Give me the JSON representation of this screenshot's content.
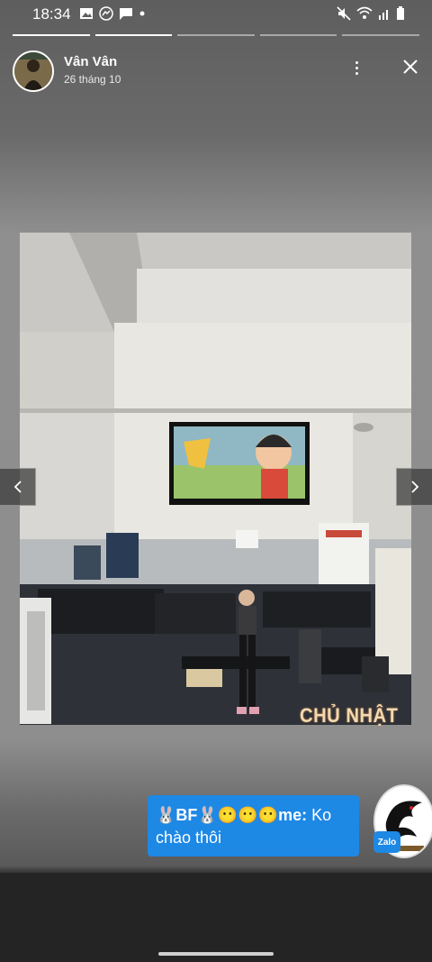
{
  "status_bar": {
    "time": "18:34",
    "left_icons": [
      "gallery-icon",
      "messenger-icon",
      "chat-icon",
      "dot-icon"
    ],
    "right_icons": [
      "mute-icon",
      "wifi-icon",
      "signal-icon",
      "battery-icon"
    ]
  },
  "story": {
    "progress_segments": 5,
    "active_segment": 2,
    "user_name": "Vân Vân",
    "date": "26 tháng 10",
    "caption": "CHỦ NHẬT"
  },
  "chat_bubble": {
    "emoji_prefix": "🐰",
    "bf_label": "BF",
    "emoji_mid": "🐰😶😶😶",
    "me_label": "me:",
    "message_line1": "Ko",
    "message_line2": "chào thôi"
  },
  "zalo": {
    "badge_label": "Zalo"
  },
  "colors": {
    "bubble": "#1e88e5",
    "caption": "#f3d9b0"
  }
}
